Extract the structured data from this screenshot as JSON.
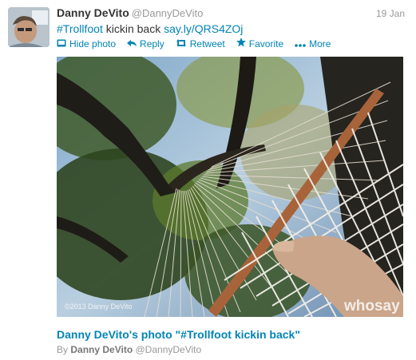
{
  "tweet": {
    "author_name": "Danny DeVito",
    "author_handle": "@DannyDeVito",
    "date": "19 Jan",
    "hashtag": "#Trollfoot",
    "text": " kickin back ",
    "short_link": "say.ly/QRS4ZOj"
  },
  "actions": {
    "hide_photo": "Hide photo",
    "reply": "Reply",
    "retweet": "Retweet",
    "favorite": "Favorite",
    "more": "More"
  },
  "photo": {
    "watermark": "©2013 Danny DeVito",
    "logo": "whosay",
    "title": "Danny DeVito's photo \"#Trollfoot kickin back\"",
    "by_label": "By",
    "by_name": "Danny DeVito",
    "by_handle": "@DannyDeVito"
  },
  "icons": {
    "hide_photo": "photo-icon",
    "reply": "reply-arrow-icon",
    "retweet": "retweet-icon",
    "favorite": "star-icon",
    "more": "dots-icon"
  },
  "colors": {
    "link": "#0084b4",
    "muted": "#999999",
    "text": "#333333"
  }
}
